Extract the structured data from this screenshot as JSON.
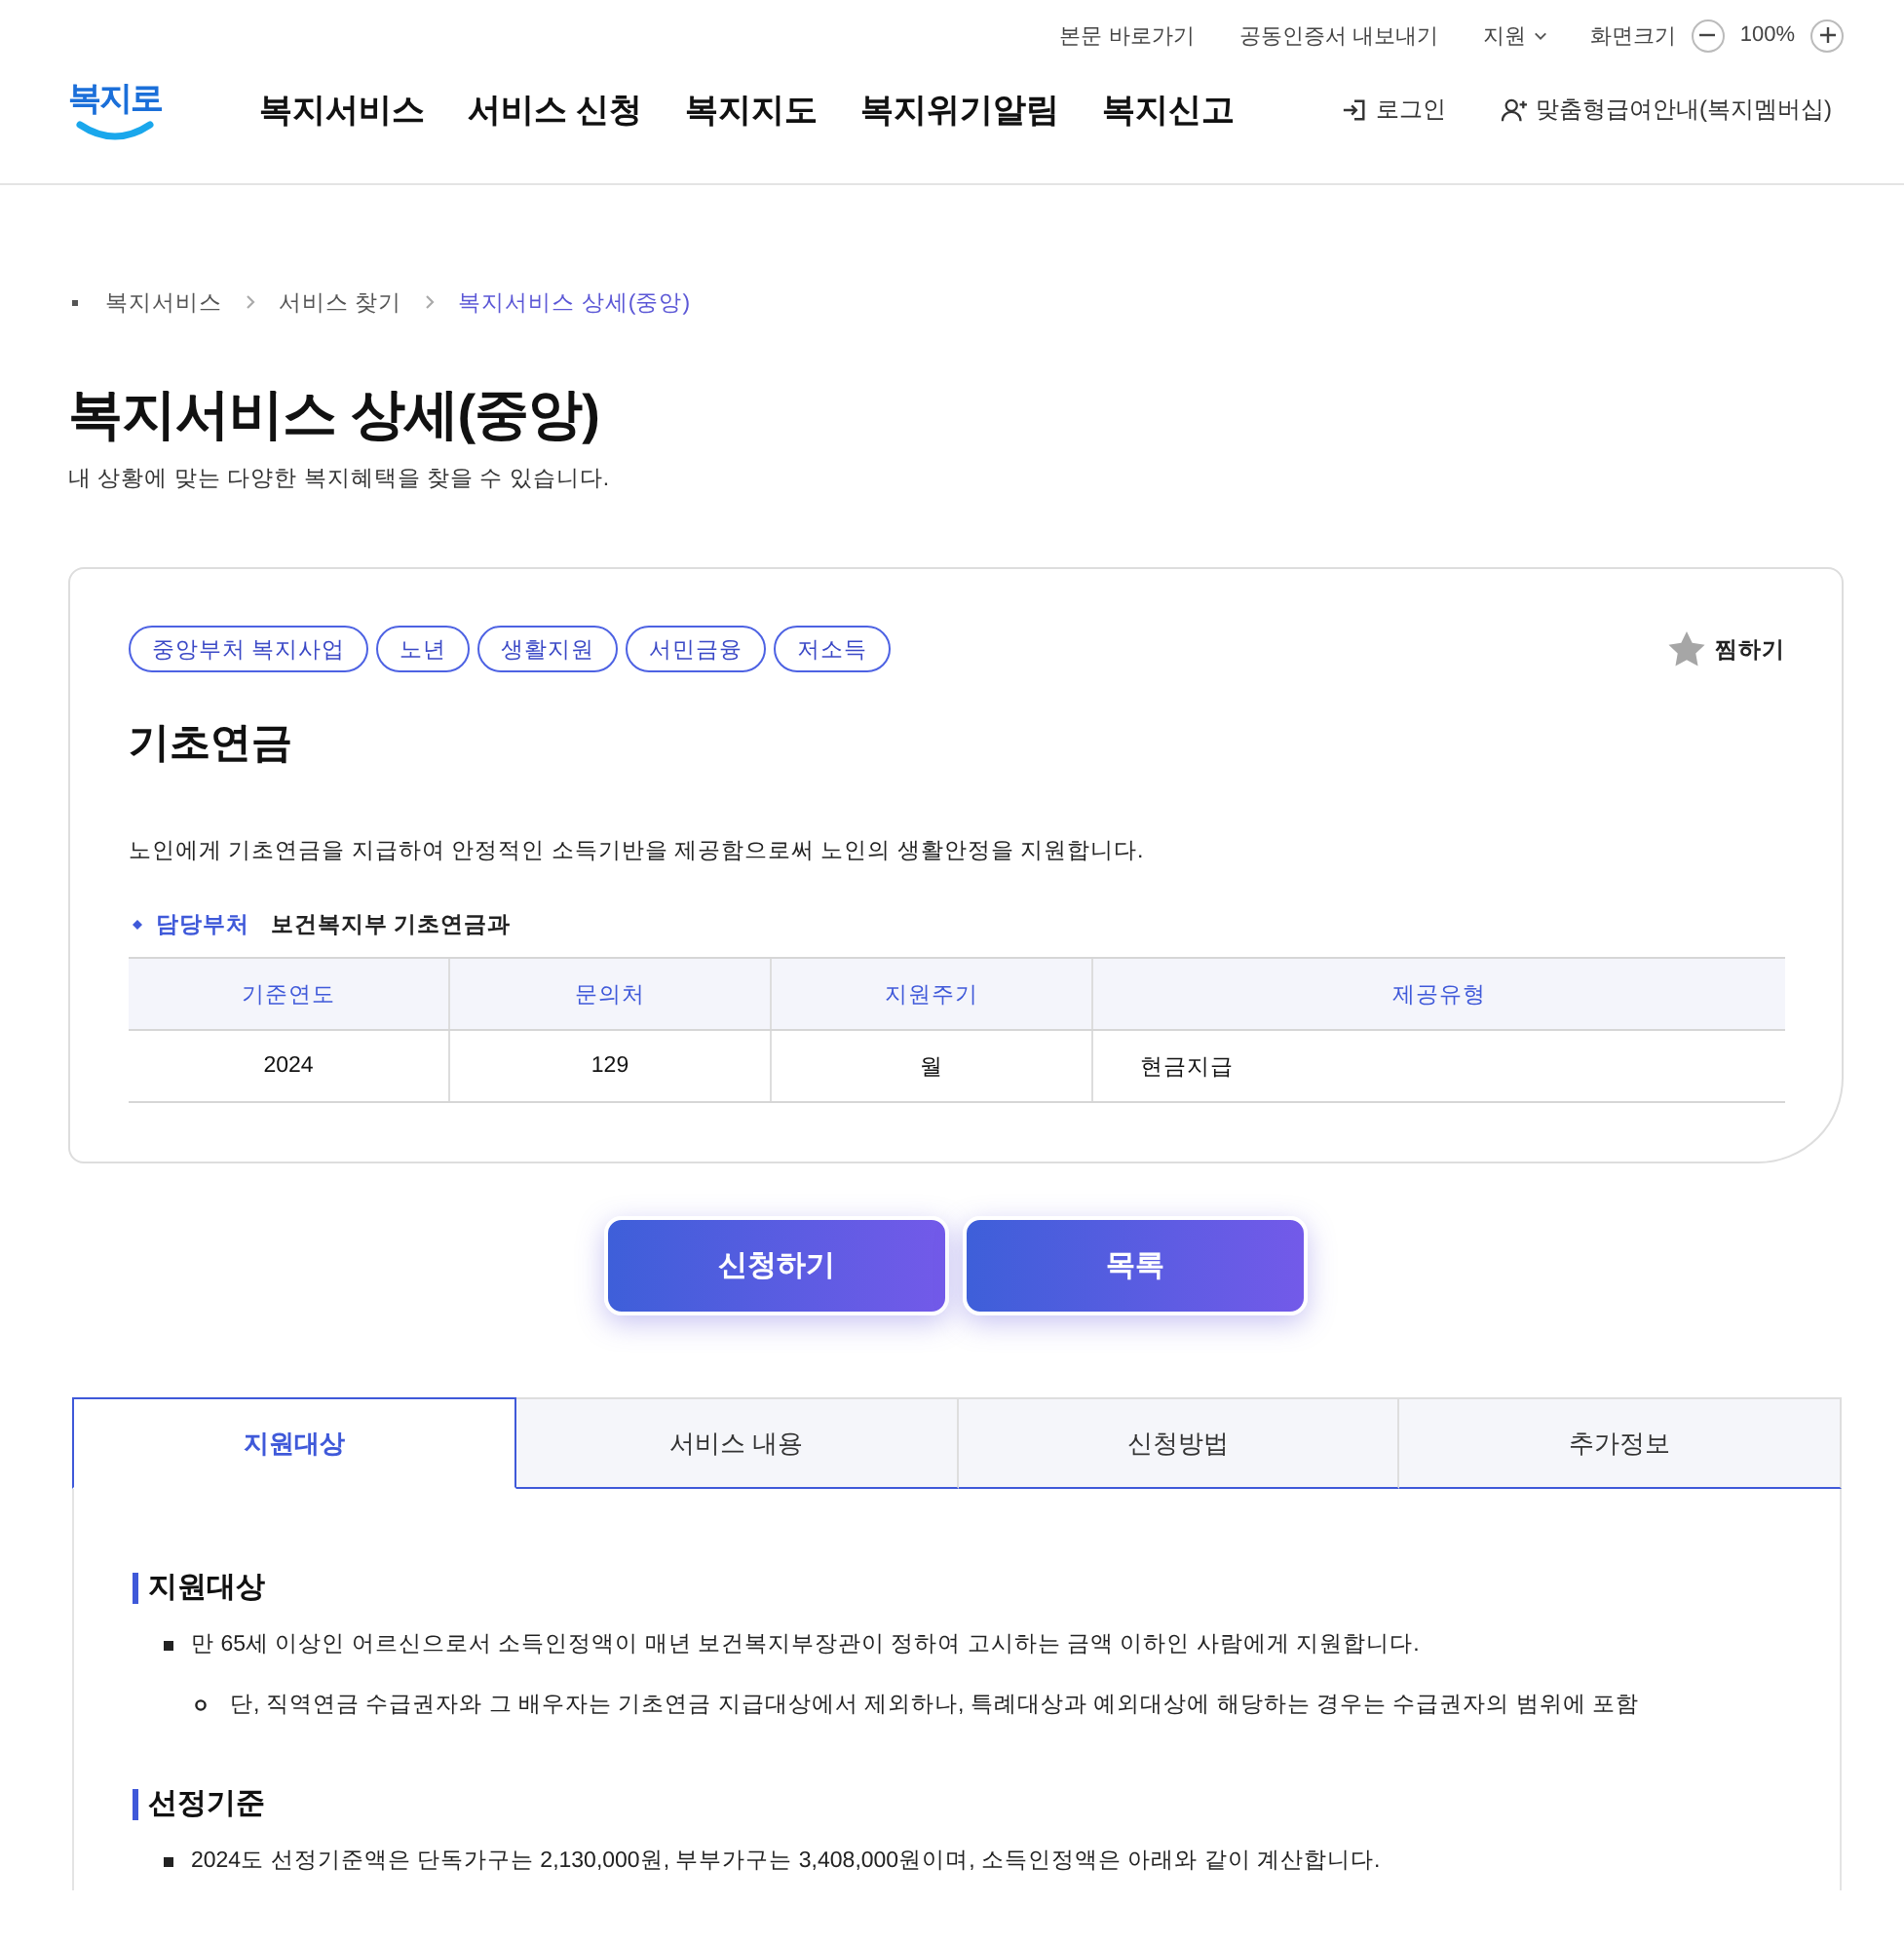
{
  "header": {
    "logo": "복지로",
    "utility_links": [
      {
        "label": "본문 바로가기",
        "has_dropdown": false
      },
      {
        "label": "공동인증서 내보내기",
        "has_dropdown": false
      },
      {
        "label": "지원",
        "has_dropdown": true
      }
    ],
    "zoom": {
      "label": "화면크기",
      "value": "100%"
    },
    "nav": [
      "복지서비스",
      "서비스 신청",
      "복지지도",
      "복지위기알림",
      "복지신고"
    ],
    "login": "로그인",
    "membership": "맞춤형급여안내(복지멤버십)"
  },
  "breadcrumb": [
    {
      "label": "복지서비스",
      "current": false
    },
    {
      "label": "서비스 찾기",
      "current": false
    },
    {
      "label": "복지서비스 상세(중앙)",
      "current": true
    }
  ],
  "page": {
    "title": "복지서비스 상세(중앙)",
    "subtitle": "내 상황에 맞는 다양한 복지혜택을 찾을 수 있습니다."
  },
  "card": {
    "tags": [
      "중앙부처 복지사업",
      "노년",
      "생활지원",
      "서민금융",
      "저소득"
    ],
    "bookmark": {
      "label": "찜하기",
      "bookmarked": false
    },
    "title": "기초연금",
    "description": "노인에게 기초연금을 지급하여 안정적인 소득기반을 제공함으로써 노인의 생활안정을 지원합니다.",
    "department": {
      "label": "담당부처",
      "value": "보건복지부 기초연금과"
    },
    "table": {
      "columns": [
        "기준연도",
        "문의처",
        "지원주기",
        "제공유형"
      ],
      "rows": [
        [
          "2024",
          "129",
          "월",
          "현금지급"
        ]
      ]
    }
  },
  "actions": [
    "신청하기",
    "목록"
  ],
  "tabs": [
    {
      "label": "지원대상",
      "selected": true
    },
    {
      "label": "서비스 내용",
      "selected": false
    },
    {
      "label": "신청방법",
      "selected": false
    },
    {
      "label": "추가정보",
      "selected": false
    }
  ],
  "sections": [
    {
      "heading": "지원대상",
      "items": [
        {
          "text": "만 65세 이상인 어르신으로서 소득인정액이 매년 보건복지부장관이 정하여 고시하는 금액 이하인 사람에게 지원합니다.",
          "children": [
            {
              "text": "단, 직역연금 수급권자와 그 배우자는 기초연금 지급대상에서 제외하나, 특례대상과 예외대상에 해당하는 경우는 수급권자의 범위에 포함"
            }
          ]
        }
      ]
    },
    {
      "heading": "선정기준",
      "items": [
        {
          "text": "2024도 선정기준액은 단독가구는 2,130,000원, 부부가구는 3,408,000원이며, 소득인정액은 아래와 같이 계산합니다."
        }
      ]
    }
  ]
}
